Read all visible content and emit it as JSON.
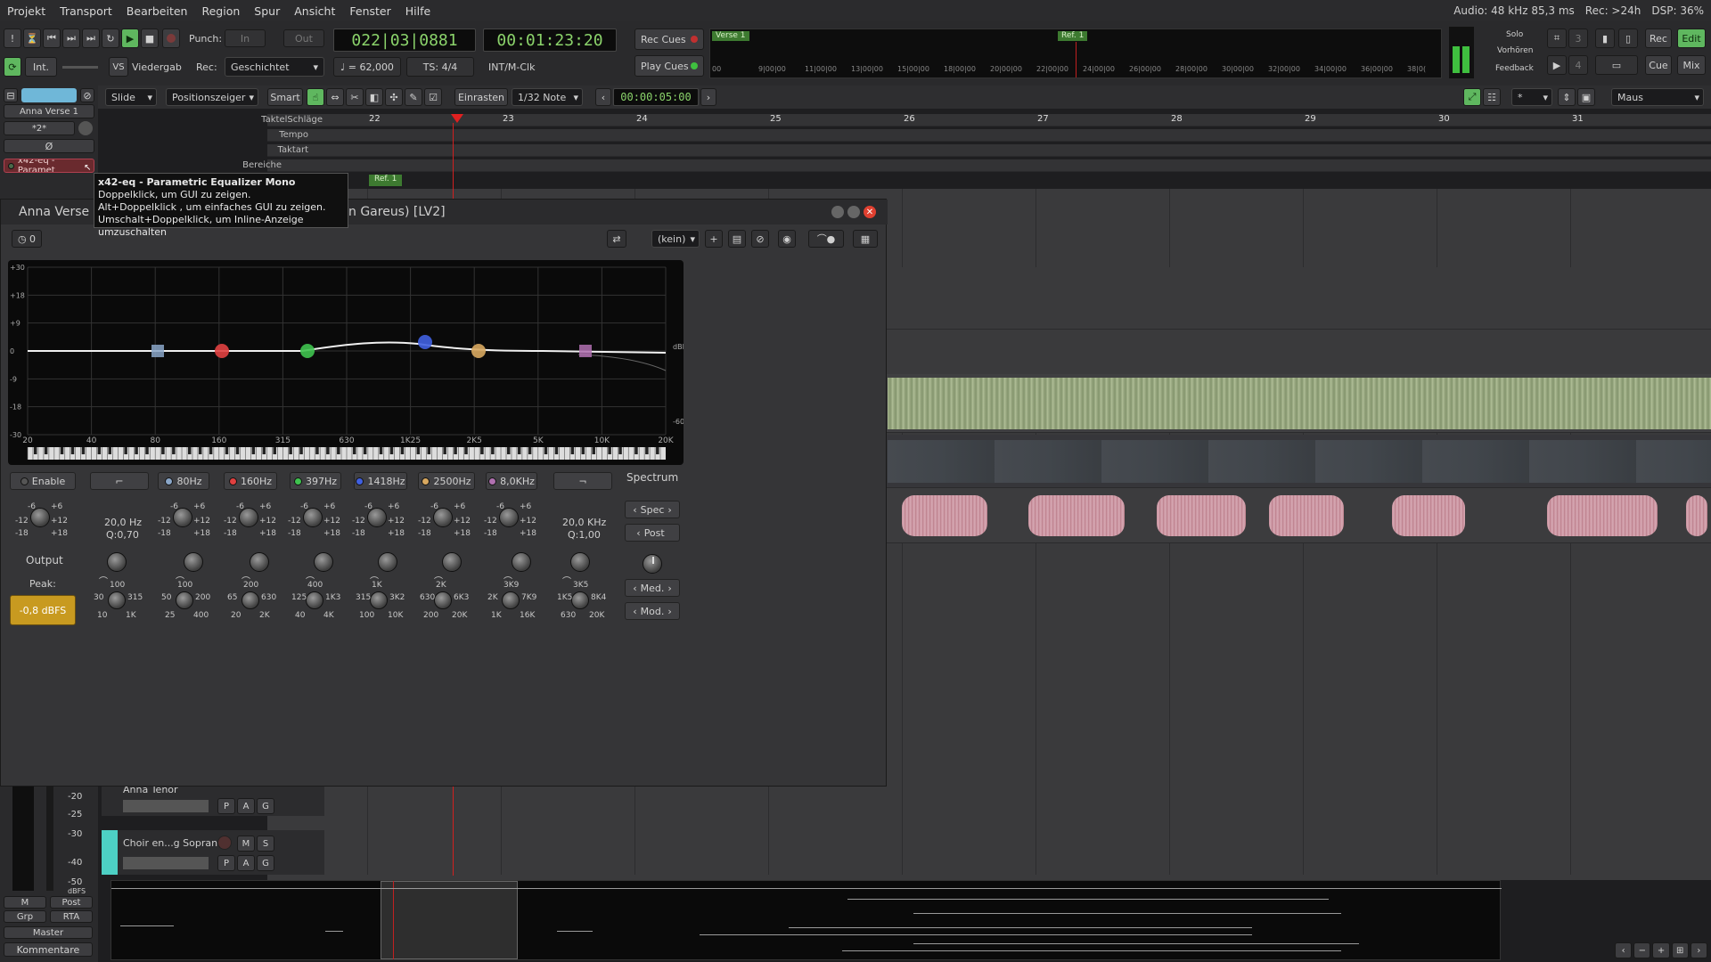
{
  "menu": {
    "items": [
      "Projekt",
      "Transport",
      "Bearbeiten",
      "Region",
      "Spur",
      "Ansicht",
      "Fenster",
      "Hilfe"
    ],
    "status_audio": "Audio: 48 kHz 85,3 ms",
    "status_rec": "Rec: >24h",
    "status_dsp": "DSP: 36%"
  },
  "transport": {
    "punch_label": "Punch:",
    "punch_in": "In",
    "punch_out": "Out",
    "int_label": "Int.",
    "vs_label": "VS",
    "playback_label": "Viedergab",
    "rec_label": "Rec:",
    "rec_mode": "Geschichtet",
    "bbt_clock": "022|03|0881",
    "timecode_clock": "00:01:23:20",
    "tempo": "♩ = 62,000",
    "meter": "TS: 4/4",
    "sync": "INT/M-Clk",
    "rec_cues": "Rec Cues",
    "play_cues": "Play Cues",
    "solo": "Solo",
    "audition": "Vorhören",
    "feedback": "Feedback",
    "right_rec": "Rec",
    "right_edit": "Edit",
    "right_cue": "Cue",
    "right_mix": "Mix",
    "num_3": "3",
    "num_4": "4"
  },
  "minitimeline": {
    "marker_verse": "Verse 1",
    "marker_ref": "Ref. 1",
    "ticks": [
      "00",
      "9|00|00",
      "11|00|00",
      "13|00|00",
      "15|00|00",
      "18|00|00",
      "20|00|00",
      "22|00|00",
      "24|00|00",
      "26|00|00",
      "28|00|00",
      "30|00|00",
      "32|00|00",
      "34|00|00",
      "36|00|00",
      "38|0("
    ]
  },
  "edit_toolbar": {
    "slide": "Slide",
    "position": "Positionszeiger",
    "smart": "Smart",
    "snap": "Einrasten",
    "grid": "1/32 Note",
    "nudge": "00:00:05:00",
    "mouse": "Maus",
    "star": "*"
  },
  "rulers": {
    "labels": [
      "TaktelSchläge",
      "Tempo",
      "Taktart",
      "Bereiche"
    ],
    "bars": [
      "22",
      "23",
      "24",
      "25",
      "26",
      "27",
      "28",
      "29",
      "30",
      "31"
    ],
    "ref_marker": "Ref. 1"
  },
  "left_panel": {
    "track_name": "Anna Verse 1",
    "phase": "Ø",
    "input": "*2*",
    "plugin_slot": "x42-eq - Paramet",
    "m_btn": "M",
    "post_btn": "Post",
    "grp_btn": "Grp",
    "rta_btn": "RTA",
    "master": "Master",
    "comments": "Kommentare",
    "meter_scale": [
      "-20",
      "-25",
      "-30",
      "-40",
      "-50",
      "dBFS"
    ]
  },
  "tooltip": {
    "title": "x42-eq - Parametric Equalizer Mono",
    "line1": "Doppelklick, um GUI zu zeigen.",
    "line2": "Alt+Doppelklick , um einfaches GUI zu zeigen.",
    "line3": "Umschalt+Doppelklick, um Inline-Anzeige umzuschalten"
  },
  "plugin": {
    "title_left": "Anna Verse 1",
    "title_right": "n Gareus) [LV2]",
    "latency": "0",
    "preset": "(kein)",
    "enable": "Enable",
    "output": "Output",
    "peak_label": "Peak:",
    "peak_value": "-0,8 dBFS",
    "spectrum": "Spectrum",
    "spec": "Spec",
    "post": "Post",
    "med": "Med.",
    "mod": "Mod.",
    "db_left": [
      "+30",
      "+18",
      "+9",
      "0",
      "-9",
      "-18",
      "-30"
    ],
    "db_right": [
      "dBFS",
      "-60"
    ],
    "freq_axis": [
      "20",
      "40",
      "80",
      "160",
      "315",
      "630",
      "1K25",
      "2K5",
      "5K",
      "10K",
      "20K"
    ],
    "bands": [
      {
        "label": "80Hz",
        "color": "#8aa6c8"
      },
      {
        "label": "160Hz",
        "color": "#e04040"
      },
      {
        "label": "397Hz",
        "color": "#3fc34f"
      },
      {
        "label": "1418Hz",
        "color": "#4060e0"
      },
      {
        "label": "2500Hz",
        "color": "#d8a860"
      },
      {
        "label": "8,0KHz",
        "color": "#b070b0"
      }
    ],
    "hp_freq": "20,0 Hz",
    "hp_q": "Q:0,70",
    "lp_freq": "20,0 KHz",
    "lp_q": "Q:1,00",
    "gain_ticks": [
      "-6",
      "+6",
      "-12",
      "+12",
      "-18",
      "+18"
    ],
    "freq_knobs": [
      {
        "center": "100",
        "lo": "30",
        "hi": "315",
        "min": "10",
        "max": "1K"
      },
      {
        "center": "100",
        "lo": "50",
        "hi": "200",
        "min": "25",
        "max": "400"
      },
      {
        "center": "200",
        "lo": "65",
        "hi": "630",
        "min": "20",
        "max": "2K"
      },
      {
        "center": "400",
        "lo": "125",
        "hi": "1K3",
        "min": "40",
        "max": "4K"
      },
      {
        "center": "1K",
        "lo": "315",
        "hi": "3K2",
        "min": "100",
        "max": "10K"
      },
      {
        "center": "2K",
        "lo": "630",
        "hi": "6K3",
        "min": "200",
        "max": "20K"
      },
      {
        "center": "3K9",
        "lo": "2K",
        "hi": "7K9",
        "min": "1K",
        "max": "16K"
      },
      {
        "center": "3K5",
        "lo": "1K5",
        "hi": "8K4",
        "min": "630",
        "max": "20K"
      }
    ]
  },
  "tracks": {
    "tenor": "Anna Tenor",
    "choir": "Choir en...g Sopran",
    "m": "M",
    "s": "S",
    "p": "P",
    "a": "A",
    "g": "G"
  }
}
